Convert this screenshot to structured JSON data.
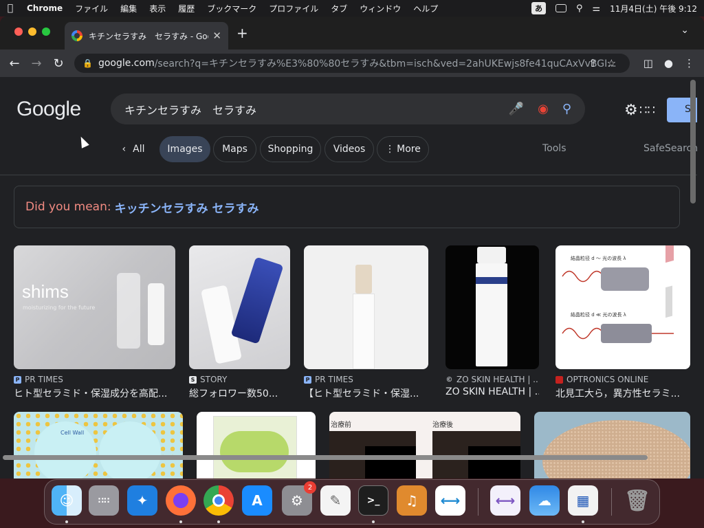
{
  "menubar": {
    "app": "Chrome",
    "items": [
      "ファイル",
      "編集",
      "表示",
      "履歴",
      "ブックマーク",
      "プロファイル",
      "タブ",
      "ウィンドウ",
      "ヘルプ"
    ],
    "ime": "あ",
    "datetime": "11月4日(土) 午後 9:12"
  },
  "tab": {
    "title": "キチンセラすみ　セラすみ - Goo",
    "close": "✕",
    "new": "+"
  },
  "address": {
    "host": "google.com",
    "path": "/search?q=キチンセラすみ%E3%80%80セラすみ&tbm=isch&ved=2ahUKEwjs8fe41quCAxVvBGI..."
  },
  "google": {
    "logo": "Google",
    "query": "キチンセラすみ　セラすみ",
    "signin": "Si"
  },
  "chips": [
    {
      "label": "All",
      "name": "chip-all"
    },
    {
      "label": "Images",
      "name": "chip-images"
    },
    {
      "label": "Maps",
      "name": "chip-maps"
    },
    {
      "label": "Shopping",
      "name": "chip-shopping"
    },
    {
      "label": "Videos",
      "name": "chip-videos"
    },
    {
      "label": "More",
      "name": "chip-more"
    }
  ],
  "tools": "Tools",
  "safesearch": "SafeSearch",
  "did_you_mean": {
    "lead": "Did you mean:",
    "suggestion": "キッチンセラすみ セラすみ"
  },
  "results": [
    {
      "source": "PR TIMES",
      "favicon": "P",
      "caption": "ヒト型セラミド・保湿成分を高配...",
      "overlay": "shims",
      "overlay2": "moisturizing for the future"
    },
    {
      "source": "STORY",
      "favicon": "S",
      "caption": "総フォロワー数50..."
    },
    {
      "source": "PR TIMES",
      "favicon": "P",
      "caption": "【ヒト型セラミド・保湿..."
    },
    {
      "source": "ZO SKIN HEALTH | ...",
      "favicon": "©",
      "caption": "ZO SKIN HEALTH | ..."
    },
    {
      "source": "OPTRONICS ONLINE",
      "favicon": "",
      "caption": "北見工大ら，異方性セラミ...",
      "label_a": "結晶粒径 d ～ 光の波長 λ",
      "label_b": "結晶粒径 d ≪ 光の波長 λ"
    }
  ],
  "row2": {
    "cell_wall": "Cell Wall",
    "before": "治療前",
    "after": "治療後"
  },
  "dock": {
    "badge": "2",
    "terminal": ">_"
  },
  "colors": {
    "accent_blue": "#8ab4f8",
    "did_you_mean": "#f28b82",
    "page_bg": "#202124"
  }
}
